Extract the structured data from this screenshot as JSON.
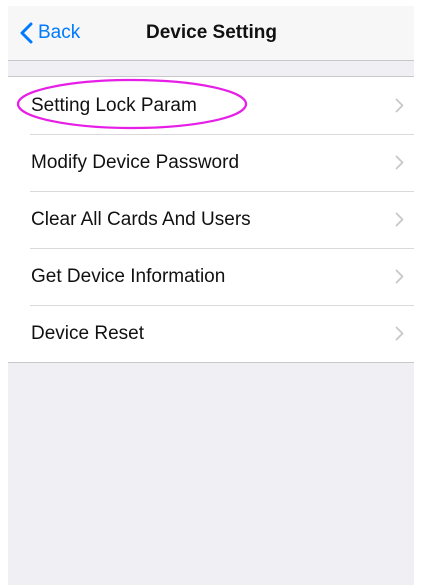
{
  "navbar": {
    "back_label": "Back",
    "title": "Device Setting"
  },
  "menu": {
    "items": [
      {
        "label": "Setting Lock Param"
      },
      {
        "label": "Modify Device Password"
      },
      {
        "label": "Clear All Cards And Users"
      },
      {
        "label": "Get Device Information"
      },
      {
        "label": "Device Reset"
      }
    ]
  },
  "icons": {
    "back": "chevron-left-icon",
    "row_disclosure": "chevron-right-icon"
  },
  "colors": {
    "accent": "#007aff",
    "background": "#efeff4",
    "highlight_annotation": "#e61ee6"
  }
}
